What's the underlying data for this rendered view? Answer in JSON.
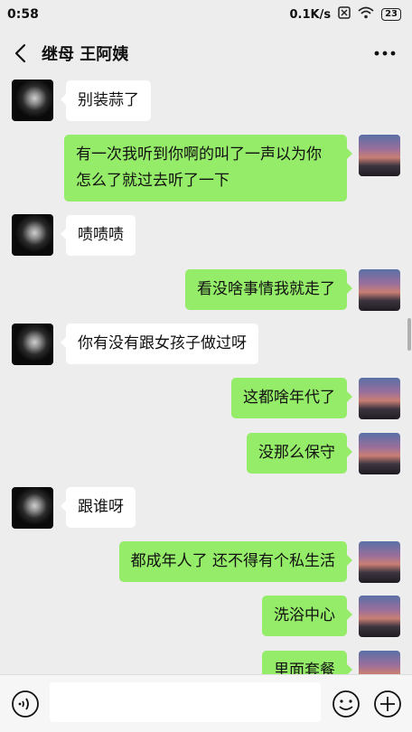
{
  "status": {
    "time": "0:58",
    "speed": "0.1K/s",
    "battery": "23"
  },
  "header": {
    "title": "继母 王阿姨"
  },
  "messages": [
    {
      "side": "left",
      "text": "别装蒜了"
    },
    {
      "side": "right",
      "text": "有一次我听到你啊的叫了一声以为你怎么了就过去听了一下"
    },
    {
      "side": "left",
      "text": "啧啧啧"
    },
    {
      "side": "right",
      "text": "看没啥事情我就走了"
    },
    {
      "side": "left",
      "text": "你有没有跟女孩子做过呀"
    },
    {
      "side": "right",
      "text": "这都啥年代了"
    },
    {
      "side": "right",
      "text": "没那么保守"
    },
    {
      "side": "left",
      "text": "跟谁呀"
    },
    {
      "side": "right",
      "text": "都成年人了  还不得有个私生活"
    },
    {
      "side": "right",
      "text": "洗浴中心"
    },
    {
      "side": "right",
      "text": "里面套餐"
    }
  ],
  "input": {
    "value": ""
  },
  "colors": {
    "background": "#ededed",
    "sent_bubble": "#95ec69",
    "received_bubble": "#ffffff"
  }
}
